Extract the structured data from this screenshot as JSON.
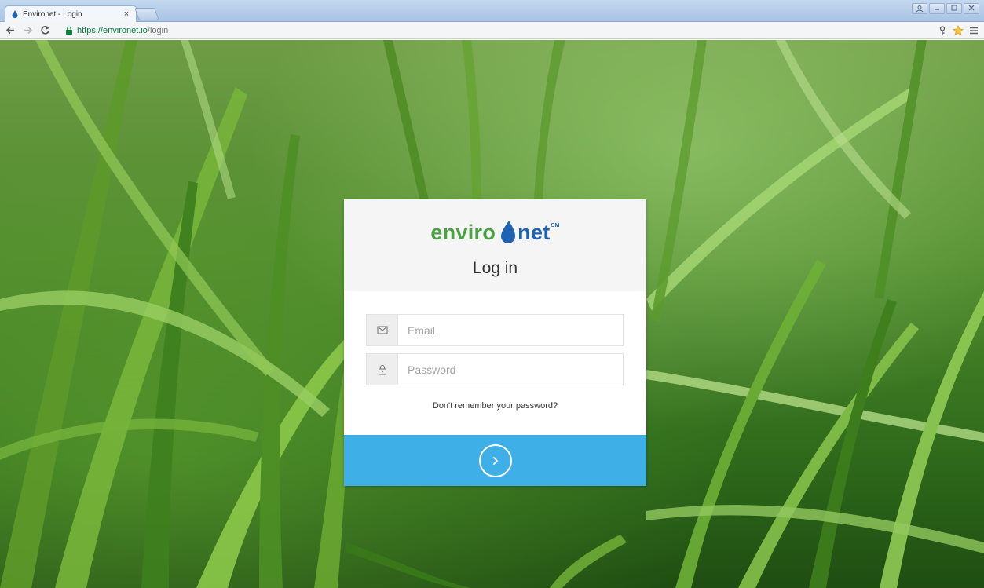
{
  "browser": {
    "tab_title": "Environet - Login",
    "tab_close": "×",
    "url_secure": "https://environet.io",
    "url_path": "/login"
  },
  "login": {
    "logo_part1": "enviro",
    "logo_part2": "net",
    "logo_mark": "SM",
    "title": "Log in",
    "email_placeholder": "Email",
    "email_value": "",
    "password_placeholder": "Password",
    "password_value": "",
    "forgot_label": "Don't remember your password?"
  },
  "colors": {
    "brand_green": "#4aa243",
    "brand_blue": "#1e63b3",
    "submit_bar": "#3fafe8"
  },
  "icons": {
    "email": "envelope-icon",
    "password": "lock-icon",
    "submit": "chevron-right-circle-icon"
  }
}
